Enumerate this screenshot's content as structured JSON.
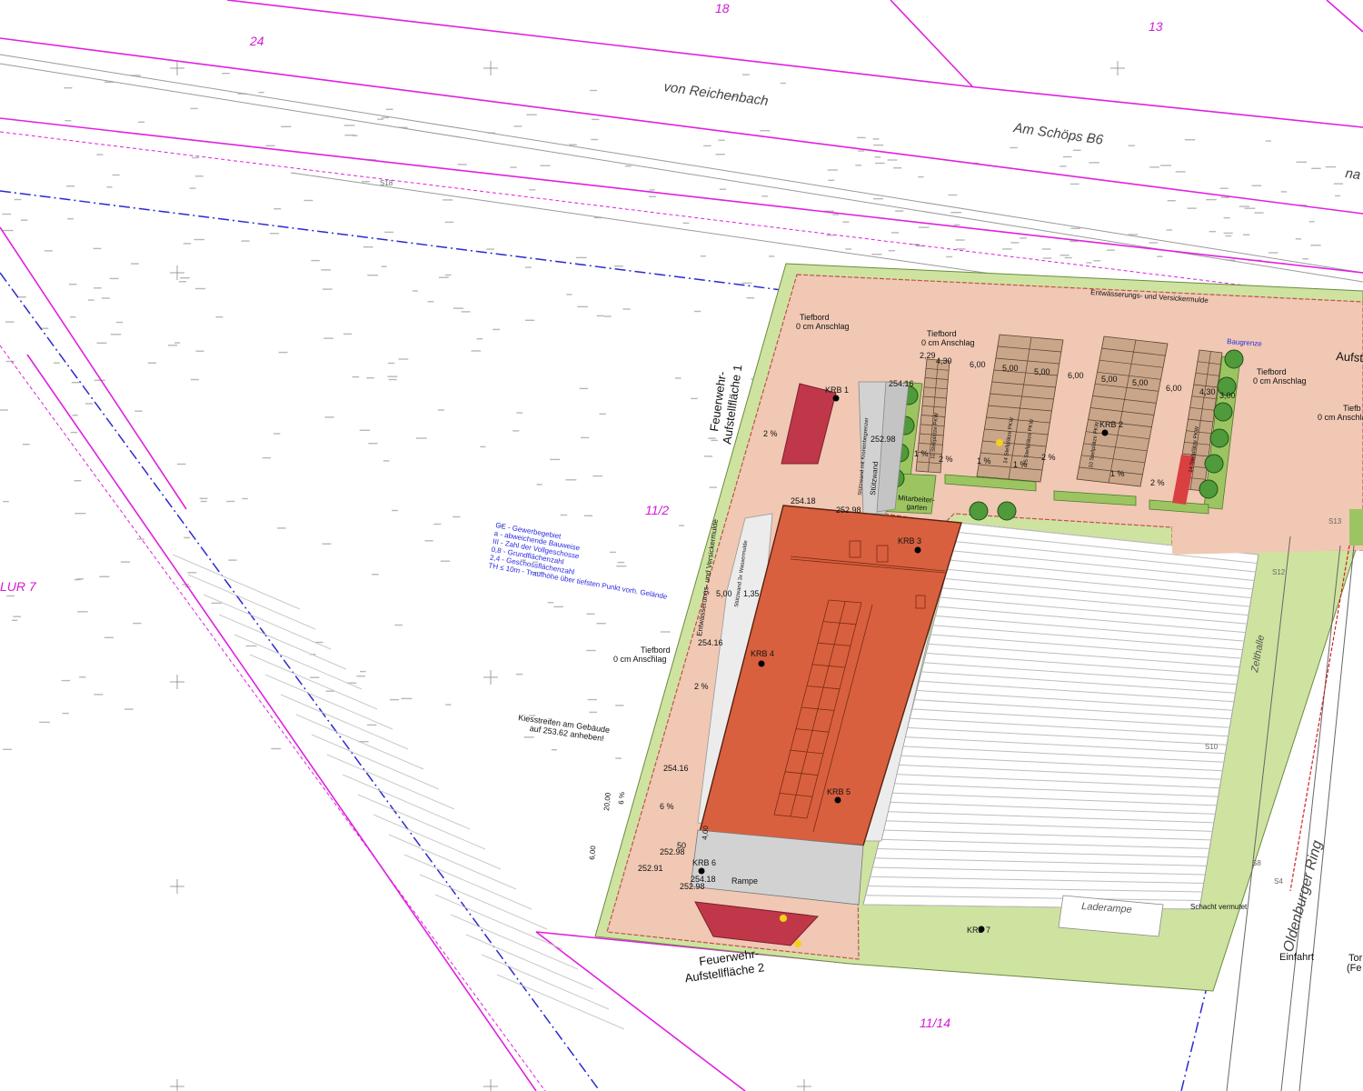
{
  "streets": {
    "reichenbach": "von Reichenbach",
    "schoeps": "Am Schöps  B6",
    "na_partial": "na",
    "oldenburger": "Oldenburger Ring"
  },
  "parcels": {
    "p24": "24",
    "p18": "18",
    "p13": "13",
    "p11_2": "11/2",
    "p11_14": "11/14",
    "flur": "LUR 7"
  },
  "labels": {
    "entwaesserung_top": "Entwässerungs- und Versickermulde",
    "entwaesserung_side": "Entwässerungs- und Versickermulde",
    "baugrenze": "Baugrenze",
    "aufst_partial": "Aufst",
    "feuerwehr1_a": "Feuerwehr-",
    "feuerwehr1_b": "Aufstellfläche 1",
    "feuerwehr2_a": "Feuerwehr-",
    "feuerwehr2_b": "Aufstellfläche 2",
    "tiefbord_1a": "Tiefbord",
    "tiefbord_1b": "0 cm Anschlag",
    "tiefbord_2a": "Tiefbord",
    "tiefbord_2b": "0 cm Anschlag",
    "tiefbord_3a": "Tiefbord",
    "tiefbord_3b": "0 cm Anschlag",
    "tiefbord_4a": "Tiefbord",
    "tiefbord_4b": "0 cm Anschlag",
    "tiefbord_5a": "Tiefb",
    "tiefbord_5b": "0 cm Anschlag",
    "kiesstreifen_a": "Kiesstreifen am Gebäude",
    "kiesstreifen_b": "auf 253.62 anheben!",
    "mitarbeiter_a": "Mitarbeiter-",
    "mitarbeiter_b": "garten",
    "zelthalle": "Zelthalle",
    "laderampe": "Laderampe",
    "rampe": "Rampe",
    "einfahrt": "Einfahrt",
    "schacht": "Schacht vermutet",
    "stuetzwand": "Stützwand",
    "stuetzwand_kran": "Stützwand mit Kronenbegrenzer",
    "stuetzwand_w": "Stützwand 3x Wassermulde",
    "stellplatz_1": "11 Stellplätze PKW",
    "stellplatz_2": "14 Stellplätze PKW",
    "stellplatz_3": "15 Stellplätze PKW",
    "stellplatz_4": "10 Stellplätze PKW",
    "stellplatz_5": "14 Stellplätze PKW",
    "tor_partial": "Tor",
    "fe_partial": "(Fe"
  },
  "legend": [
    "GE - Gewerbegebiet",
    "a - abweichende Bauweise",
    "III - Zahl der Vollgeschosse",
    "0,8 - Grundflächenzahl",
    "2,4 - Geschossflächenzahl",
    "TH ≤ 10m - Traufhöhe über tiefsten Punkt vorh. Gelände"
  ],
  "krb": {
    "k1": "KRB 1",
    "k2": "KRB 2",
    "k3": "KRB 3",
    "k4": "KRB 4",
    "k5": "KRB 5",
    "k6": "KRB 6",
    "k7": "KRB 7"
  },
  "dims": {
    "d_229": "2,29",
    "d_430a": "4,30",
    "d_600a": "6,00",
    "d_500a": "5,00",
    "d_500b": "5,00",
    "d_600b": "6,00",
    "d_500c": "5,00",
    "d_500d": "5,00",
    "d_600c": "6,00",
    "d_430b": "4,30",
    "d_300": "3,00",
    "d_500e": "5,00",
    "d_135": "1,35",
    "d_400": "4,00",
    "d_600d": "6,00",
    "d_2000": "20,00",
    "d_50": "50"
  },
  "slopes": {
    "s1": "2 %",
    "s2": "1 %",
    "s3": "2 %",
    "s4": "1 %",
    "s5": "1 %",
    "s6": "2 %",
    "s7": "1 %",
    "s8": "2 %",
    "s9": "2 %",
    "s10": "6 %",
    "s11": "6 %"
  },
  "heights": {
    "h1": "254.16",
    "h2": "252.98",
    "h3": "254.18",
    "h4": "252.98",
    "h5": "254.16",
    "h6": "254.16",
    "h7": "252.98",
    "h8": "252.91",
    "h9": "254.18",
    "h10": "252.98"
  },
  "survey": {
    "s18": "S18",
    "s12": "S12",
    "s10": "S10",
    "s8": "S8",
    "s4": "S4",
    "s13": "S13"
  },
  "colors": {
    "parcel_line": "#e020e0",
    "boundary_blue": "#2a2ad0",
    "site_fill": "#f0c8b4",
    "green_strip": "#cfe3a0",
    "building": "#d8603e",
    "parking": "#c9a689",
    "hatch_red": "#c0374a",
    "tree": "#4f9a3a",
    "gravel": "#e8e8e8",
    "hall_lines": "#bdbdbd"
  }
}
